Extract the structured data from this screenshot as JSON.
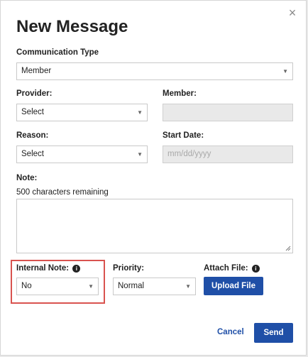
{
  "dialog": {
    "title": "New Message",
    "close_glyph": "×"
  },
  "communication_type": {
    "label": "Communication Type",
    "value": "Member"
  },
  "provider": {
    "label": "Provider:",
    "value": "Select"
  },
  "member": {
    "label": "Member:",
    "value": ""
  },
  "reason": {
    "label": "Reason:",
    "value": "Select"
  },
  "start_date": {
    "label": "Start Date:",
    "placeholder": "mm/dd/yyyy"
  },
  "note": {
    "label": "Note:",
    "remaining": "500 characters remaining",
    "value": ""
  },
  "internal_note": {
    "label": "Internal Note:",
    "value": "No",
    "info_glyph": "i"
  },
  "priority": {
    "label": "Priority:",
    "value": "Normal"
  },
  "attach_file": {
    "label": "Attach File:",
    "button": "Upload File",
    "info_glyph": "i"
  },
  "actions": {
    "cancel": "Cancel",
    "send": "Send"
  },
  "colors": {
    "primary": "#1f4fa7",
    "highlight_border": "#d9534f",
    "disabled_bg": "#e9e9e9"
  },
  "icons": {
    "close": "close-icon",
    "caret": "chevron-down-icon",
    "info": "info-icon",
    "resize": "resize-grip-icon"
  }
}
